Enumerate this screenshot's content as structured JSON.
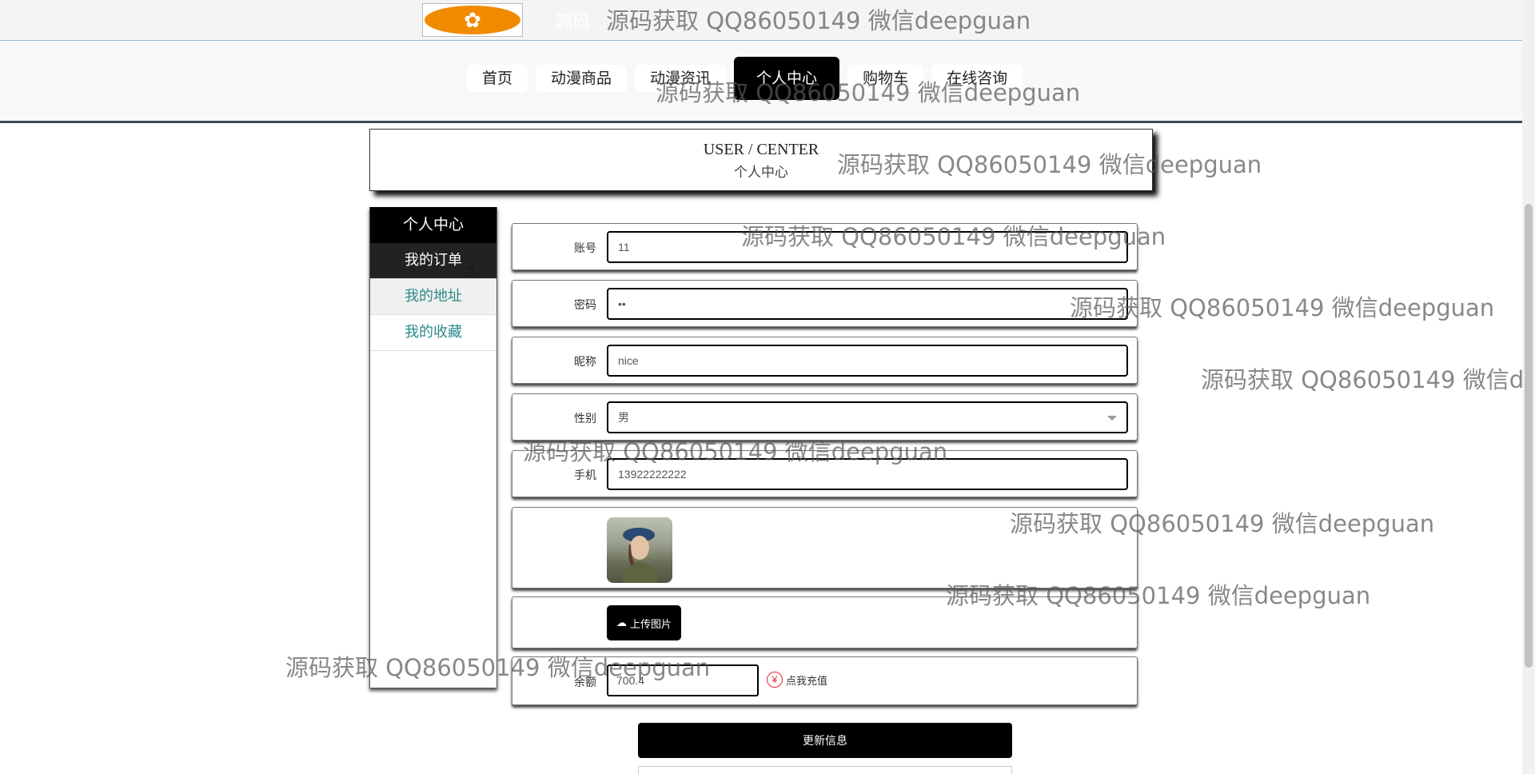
{
  "header": {
    "site_title": "源码",
    "nav": [
      "首页",
      "动漫商品",
      "动漫资讯",
      "个人中心",
      "购物车",
      "在线咨询"
    ]
  },
  "user_center": {
    "en": "USER / CENTER",
    "cn": "个人中心"
  },
  "sidebar": {
    "title": "个人中心",
    "items": [
      "我的订单",
      "我的地址",
      "我的收藏"
    ]
  },
  "form": {
    "account_label": "账号",
    "account_value": "11",
    "password_label": "密码",
    "password_value": "••",
    "nickname_label": "昵称",
    "nickname_value": "nice",
    "gender_label": "性别",
    "gender_value": "男",
    "phone_label": "手机",
    "phone_value": "13922222222",
    "upload_label": "上传图片",
    "balance_label": "余额",
    "balance_value": "700.4",
    "recharge_label": "点我充值",
    "update_label": "更新信息"
  },
  "watermark": "源码获取 QQ86050149 微信deepguan",
  "icons": {
    "upload": "cloud-upload-icon",
    "yen": "yen-icon",
    "caret": "caret-down-icon",
    "cursor": "hand-cursor-icon"
  },
  "colors": {
    "accent": "#000000",
    "link": "#2b8a8a",
    "logo": "#f28a00"
  }
}
